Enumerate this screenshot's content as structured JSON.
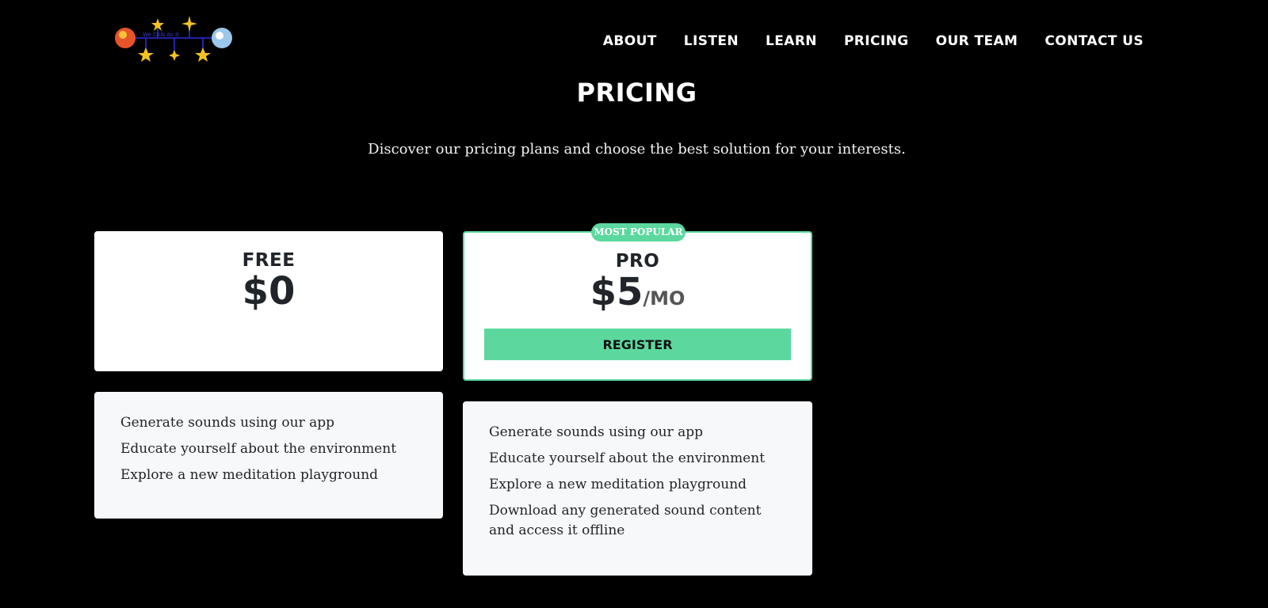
{
  "brand": {
    "logo_text": "We CAN do It"
  },
  "nav": {
    "items": [
      "ABOUT",
      "LISTEN",
      "LEARN",
      "PRICING",
      "OUR TEAM",
      "CONTACT US"
    ]
  },
  "header": {
    "title": "PRICING",
    "subtitle": "Discover our pricing plans and choose the best solution for your interests."
  },
  "plans": [
    {
      "name": "FREE",
      "price": "$0",
      "features": [
        "Generate sounds using our app",
        "Educate yourself about the environment",
        "Explore a new meditation playground"
      ]
    },
    {
      "name": "PRO",
      "price": "$5",
      "period": "/MO",
      "badge": "MOST POPULAR",
      "cta": "REGISTER",
      "features": [
        "Generate sounds using our app",
        "Educate yourself about the environment",
        "Explore a new meditation playground",
        "Download any generated sound content and access it offline"
      ]
    }
  ],
  "colors": {
    "background": "#000000",
    "accent": "#5cd89f",
    "card": "#ffffff",
    "feature_card": "#f7f8f9",
    "text_dark": "#212529"
  }
}
